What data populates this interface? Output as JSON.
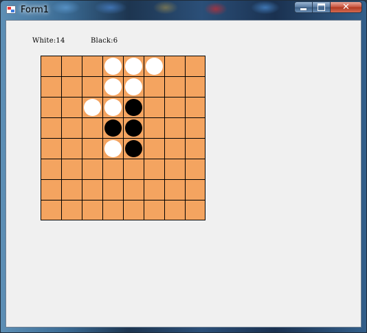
{
  "window": {
    "title": "Form1",
    "minimize_glyph": "minimize-icon",
    "maximize_glyph": "maximize-icon",
    "close_label": "✕"
  },
  "scores": {
    "white_text": "White:14",
    "black_text": "Black:6"
  },
  "board": {
    "rows": 8,
    "cols": 8,
    "board_color": "#f4a460",
    "grid_color": "#000000",
    "pieces": [
      {
        "row": 0,
        "col": 3,
        "color": "white"
      },
      {
        "row": 0,
        "col": 4,
        "color": "white"
      },
      {
        "row": 0,
        "col": 5,
        "color": "white"
      },
      {
        "row": 1,
        "col": 3,
        "color": "white"
      },
      {
        "row": 1,
        "col": 4,
        "color": "white"
      },
      {
        "row": 2,
        "col": 2,
        "color": "white"
      },
      {
        "row": 2,
        "col": 3,
        "color": "white"
      },
      {
        "row": 2,
        "col": 4,
        "color": "black"
      },
      {
        "row": 3,
        "col": 3,
        "color": "black"
      },
      {
        "row": 3,
        "col": 4,
        "color": "black"
      },
      {
        "row": 4,
        "col": 3,
        "color": "white"
      },
      {
        "row": 4,
        "col": 4,
        "color": "black"
      }
    ]
  }
}
